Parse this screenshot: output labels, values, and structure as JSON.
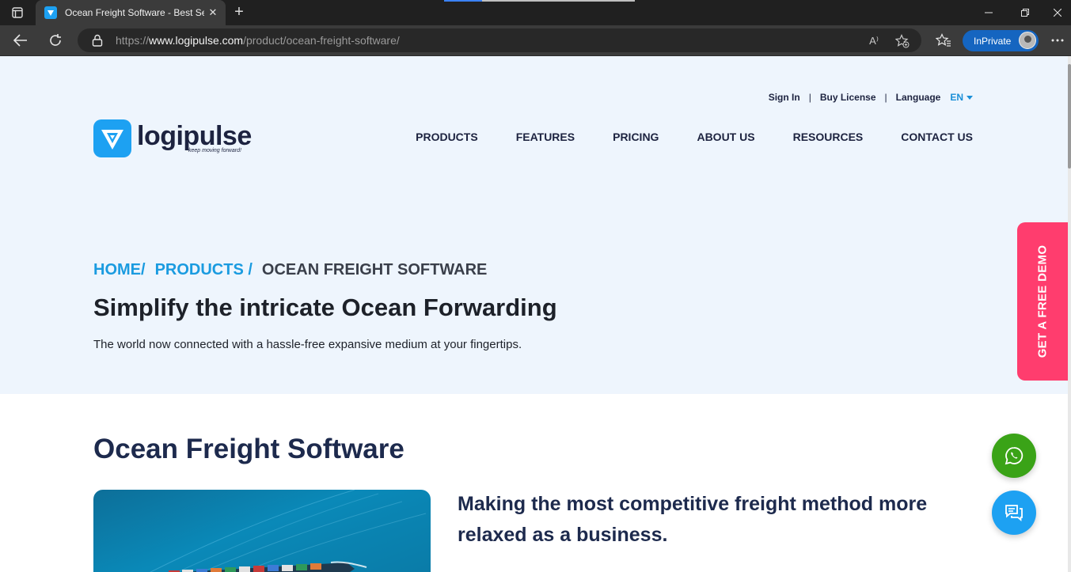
{
  "browser": {
    "tab_title": "Ocean Freight Software - Best Se",
    "url_prefix": "https://",
    "url_host": "www.logipulse.com",
    "url_path": "/product/ocean-freight-software/",
    "inprivate_label": "InPrivate",
    "read_aloud_label": "A⁾"
  },
  "header": {
    "top_links": {
      "sign_in": "Sign In",
      "separator": "|",
      "buy_license": "Buy License",
      "language_label": "Language",
      "language_value": "EN"
    },
    "logo": {
      "text": "logipulse",
      "tagline": "keep moving forward!"
    },
    "nav": [
      "PRODUCTS",
      "FEATURES",
      "PRICING",
      "ABOUT US",
      "RESOURCES",
      "CONTACT US"
    ]
  },
  "hero": {
    "breadcrumb": {
      "home": "HOME/",
      "products": "PRODUCTS /",
      "current": "OCEAN FREIGHT SOFTWARE"
    },
    "title": "Simplify the intricate Ocean Forwarding",
    "subtitle": "The world now connected with a hassle-free expansive medium at your fingertips."
  },
  "demo_tab": {
    "label": "GET A FREE DEMO"
  },
  "content": {
    "section_title": "Ocean Freight Software",
    "feature_heading": "Making the most competitive freight method more relaxed as a business."
  },
  "colors": {
    "brand_blue": "#1da1f2",
    "navy": "#1d2340",
    "demo_pink": "#ff3d6e",
    "whatsapp_green": "#3aa317",
    "hero_bg": "#eef5fd"
  },
  "icons": [
    "window-menu-icon",
    "tab-close-icon",
    "new-tab-icon",
    "back-icon",
    "refresh-icon",
    "lock-icon",
    "read-aloud-icon",
    "favorite-add-icon",
    "favorites-icon",
    "more-icon",
    "whatsapp-icon",
    "chat-icon"
  ]
}
